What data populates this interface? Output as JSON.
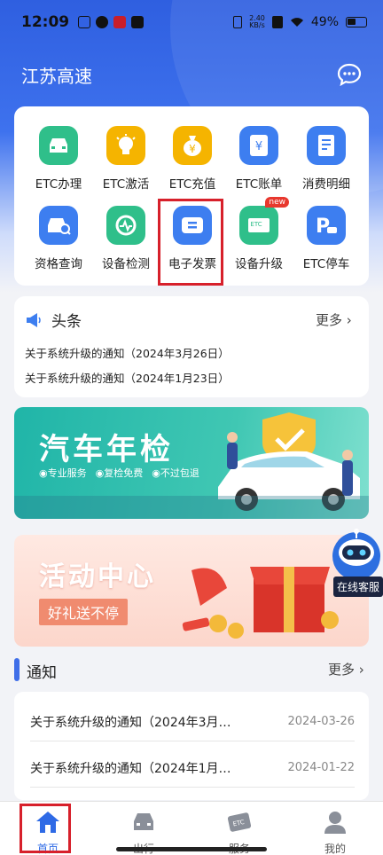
{
  "status_bar": {
    "time": "12:09",
    "net_speed_value": "2.40",
    "net_speed_unit": "KB/s",
    "battery": "49%"
  },
  "header": {
    "title": "江苏高速"
  },
  "services": [
    {
      "label": "ETC办理",
      "icon": "car-icon",
      "color": "#2fbf8a"
    },
    {
      "label": "ETC激活",
      "icon": "lightbulb-icon",
      "color": "#f5b400"
    },
    {
      "label": "ETC充值",
      "icon": "money-bag-icon",
      "color": "#f5b400"
    },
    {
      "label": "ETC账单",
      "icon": "yen-bill-icon",
      "color": "#3d7ef0"
    },
    {
      "label": "消费明细",
      "icon": "receipt-icon",
      "color": "#3d7ef0"
    },
    {
      "label": "资格查询",
      "icon": "car-search-icon",
      "color": "#3d7ef0"
    },
    {
      "label": "设备检测",
      "icon": "device-check-icon",
      "color": "#2fbf8a"
    },
    {
      "label": "电子发票",
      "icon": "invoice-icon",
      "color": "#3d7ef0"
    },
    {
      "label": "设备升级",
      "icon": "etc-card-icon",
      "color": "#2fbf8a",
      "badge": "new"
    },
    {
      "label": "ETC停车",
      "icon": "parking-icon",
      "color": "#3d7ef0"
    }
  ],
  "headlines": {
    "title": "头条",
    "more": "更多",
    "items": [
      "关于系统升级的通知（2024年3月26日）",
      "关于系统升级的通知（2024年1月23日）"
    ]
  },
  "banner_inspection": {
    "title": "汽车年检",
    "tags": [
      "专业服务",
      "复检免费",
      "不过包退"
    ]
  },
  "banner_activity": {
    "title": "活动中心",
    "subtitle": "好礼送不停"
  },
  "customer_service": {
    "label": "在线客服"
  },
  "notices": {
    "title": "通知",
    "more": "更多",
    "items": [
      {
        "text": "关于系统升级的通知（2024年3月…",
        "date": "2024-03-26"
      },
      {
        "text": "关于系统升级的通知（2024年1月…",
        "date": "2024-01-22"
      }
    ]
  },
  "tabbar": [
    {
      "label": "首页",
      "icon": "home-icon",
      "active": true
    },
    {
      "label": "出行",
      "icon": "car-icon",
      "active": false
    },
    {
      "label": "服务",
      "icon": "etc-card-icon",
      "active": false
    },
    {
      "label": "我的",
      "icon": "person-icon",
      "active": false
    }
  ],
  "colors": {
    "brand": "#3e72ee",
    "highlight": "#d7202b",
    "green": "#2fbf8a",
    "yellow": "#f5b400",
    "blue": "#3d7ef0"
  }
}
